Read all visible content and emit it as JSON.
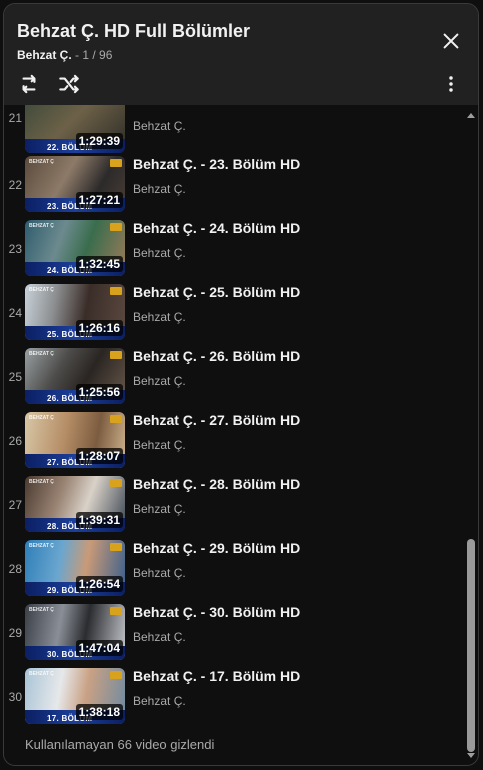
{
  "header": {
    "title": "Behzat Ç. HD Full Bölümler",
    "channel": "Behzat Ç.",
    "separator": " - ",
    "position": "1 / 96"
  },
  "icons": {
    "close": "close-icon",
    "loop": "loop-icon",
    "shuffle": "shuffle-icon",
    "menu": "more-vert-icon"
  },
  "playlist": {
    "items": [
      {
        "index": "21",
        "title": "",
        "channel": "Behzat Ç.",
        "duration": "1:29:39",
        "episode": "22. BÖLÜM"
      },
      {
        "index": "22",
        "title": "Behzat Ç. - 23. Bölüm HD",
        "channel": "Behzat Ç.",
        "duration": "1:27:21",
        "episode": "23. BÖLÜM"
      },
      {
        "index": "23",
        "title": "Behzat Ç. - 24. Bölüm HD",
        "channel": "Behzat Ç.",
        "duration": "1:32:45",
        "episode": "24. BÖLÜM"
      },
      {
        "index": "24",
        "title": "Behzat Ç. - 25. Bölüm HD",
        "channel": "Behzat Ç.",
        "duration": "1:26:16",
        "episode": "25. BÖLÜM"
      },
      {
        "index": "25",
        "title": "Behzat Ç. - 26. Bölüm HD",
        "channel": "Behzat Ç.",
        "duration": "1:25:56",
        "episode": "26. BÖLÜM"
      },
      {
        "index": "26",
        "title": "Behzat Ç. - 27. Bölüm HD",
        "channel": "Behzat Ç.",
        "duration": "1:28:07",
        "episode": "27. BÖLÜM"
      },
      {
        "index": "27",
        "title": "Behzat Ç. - 28. Bölüm HD",
        "channel": "Behzat Ç.",
        "duration": "1:39:31",
        "episode": "28. BÖLÜM"
      },
      {
        "index": "28",
        "title": "Behzat Ç. - 29. Bölüm HD",
        "channel": "Behzat Ç.",
        "duration": "1:26:54",
        "episode": "29. BÖLÜM"
      },
      {
        "index": "29",
        "title": "Behzat Ç. - 30. Bölüm HD",
        "channel": "Behzat Ç.",
        "duration": "1:47:04",
        "episode": "30. BÖLÜM"
      },
      {
        "index": "30",
        "title": "Behzat Ç. - 17. Bölüm HD",
        "channel": "Behzat Ç.",
        "duration": "1:38:18",
        "episode": "17. BÖLÜM"
      }
    ],
    "hidden_note": "Kullanılamayan 66 video gizlendi"
  },
  "colors": {
    "panel": "#212121",
    "list_bg": "#0f0f0f",
    "text_primary": "#f1f1f1",
    "text_secondary": "#aaaaaa",
    "episode_band": "#1d3f9a"
  }
}
